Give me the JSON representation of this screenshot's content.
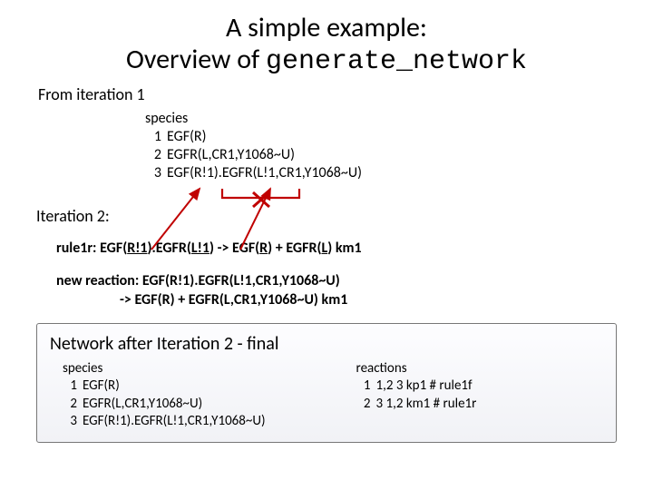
{
  "title_line1": "A simple example:",
  "title_line2_a": "Overview of ",
  "title_line2_b": "generate_network",
  "from_iter": "From iteration 1",
  "species_hdr": "species",
  "species": [
    {
      "idx": "1",
      "txt": "EGF(R)"
    },
    {
      "idx": "2",
      "txt": "EGFR(L,CR1,Y1068~U)"
    },
    {
      "idx": "3",
      "txt": "EGF(R!1).EGFR(L!1,CR1,Y1068~U)"
    }
  ],
  "iter2_label": "Iteration 2:",
  "rule": {
    "pre": "rule1r: EGF(",
    "u1": "R!1",
    "mid1": ").EGFR(",
    "u2": "L!1",
    "mid2": ") -> EGF(",
    "u3": "R",
    "mid3": ") + EGFR(",
    "u4": "L",
    "post": ") km1"
  },
  "newreact": {
    "line1": "new reaction: EGF(R!1).EGFR(L!1,CR1,Y1068~U)",
    "line2": "-> EGF(R) + EGFR(L,CR1,Y1068~U) km1"
  },
  "box_title": "Network after Iteration 2 - final",
  "box_species_hdr": "species",
  "box_species": [
    {
      "idx": "1",
      "txt": "EGF(R)"
    },
    {
      "idx": "2",
      "txt": "EGFR(L,CR1,Y1068~U)"
    },
    {
      "idx": "3",
      "txt": "EGF(R!1).EGFR(L!1,CR1,Y1068~U)"
    }
  ],
  "box_react_hdr": "reactions",
  "box_reactions": [
    {
      "idx": "1",
      "txt": "1,2 3 kp1 # rule1f"
    },
    {
      "idx": "2",
      "txt": "3 1,2 km1 # rule1r"
    }
  ]
}
